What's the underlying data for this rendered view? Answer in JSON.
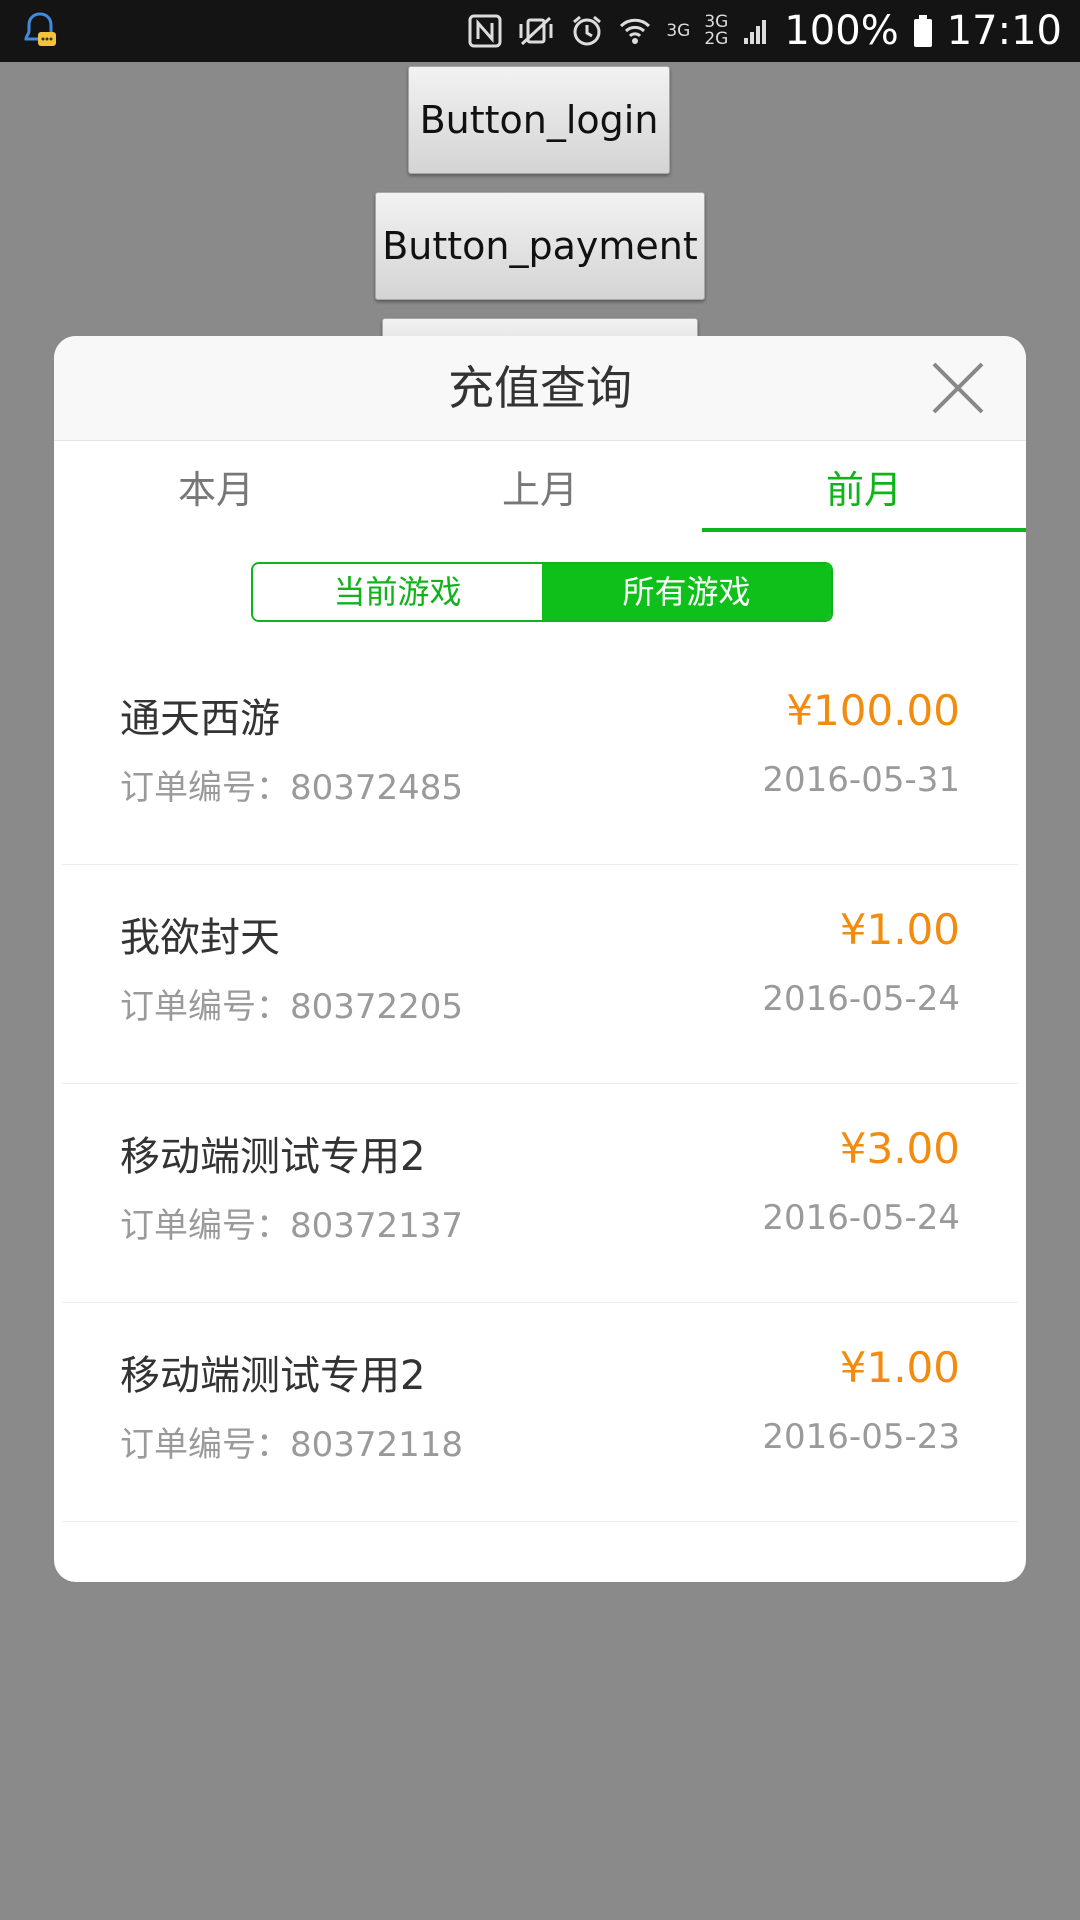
{
  "status_bar": {
    "battery": "100%",
    "time": "17:10",
    "net_top": "3G",
    "net_mid": "3G",
    "net_low": "2G"
  },
  "background": {
    "login_label": "Button_login",
    "payment_label": "Button_payment"
  },
  "dialog": {
    "title": "充值查询",
    "tabs": [
      {
        "label": "本月",
        "active": false
      },
      {
        "label": "上月",
        "active": false
      },
      {
        "label": "前月",
        "active": true
      }
    ],
    "segment": {
      "current_game": "当前游戏",
      "all_games": "所有游戏",
      "selected": "所有游戏"
    },
    "records": [
      {
        "name": "通天西游",
        "amount": "¥100.00",
        "order": "订单编号：80372485",
        "date": "2016-05-31"
      },
      {
        "name": "我欲封天",
        "amount": "¥1.00",
        "order": "订单编号：80372205",
        "date": "2016-05-24"
      },
      {
        "name": "移动端测试专用2",
        "amount": "¥3.00",
        "order": "订单编号：80372137",
        "date": "2016-05-24"
      },
      {
        "name": "移动端测试专用2",
        "amount": "¥1.00",
        "order": "订单编号：80372118",
        "date": "2016-05-23"
      }
    ]
  },
  "colors": {
    "accent_green": "#10b31b",
    "amount_orange": "#f28c0f",
    "overlay_gray": "#8a8a8a"
  }
}
